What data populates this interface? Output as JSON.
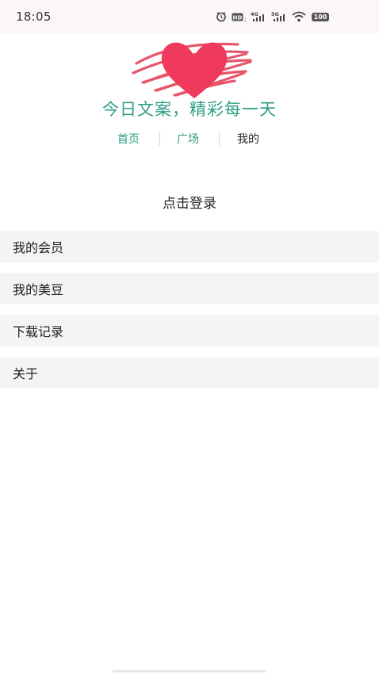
{
  "status_bar": {
    "time": "18:05",
    "battery": "100",
    "icons": [
      "alarm-icon",
      "hd-icon",
      "4g-signal-icon",
      "5g-signal-icon",
      "wifi-icon",
      "battery-icon"
    ],
    "labels": {
      "hd": "HD",
      "g4": "4G",
      "g5": "5G"
    }
  },
  "header": {
    "logo": "heart-scribble-logo",
    "slogan": "今日文案，精彩每一天"
  },
  "nav": {
    "items": [
      {
        "label": "首页"
      },
      {
        "label": "广场"
      },
      {
        "label": "我的"
      }
    ]
  },
  "profile": {
    "login_label": "点击登录"
  },
  "menu": {
    "items": [
      {
        "label": "我的会员"
      },
      {
        "label": "我的美豆"
      },
      {
        "label": "下载记录"
      },
      {
        "label": "关于"
      }
    ]
  },
  "colors": {
    "accent": "#2f9d86",
    "heart": "#ef3a5d",
    "scribble": "#e4485f",
    "menu_bg": "#f4f4f4"
  }
}
